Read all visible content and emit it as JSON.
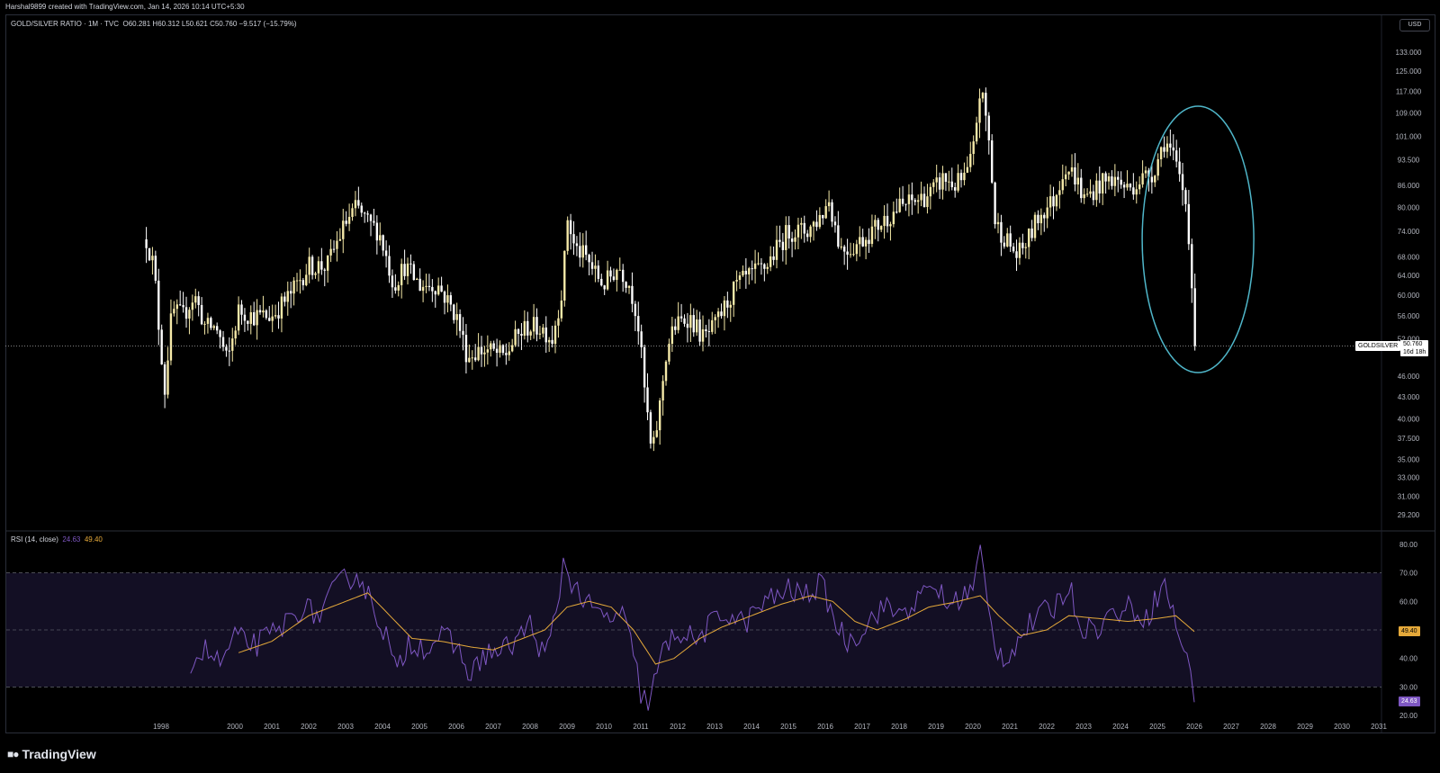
{
  "header": {
    "credit": "Harshal9899 created with TradingView.com, Jan 14, 2026 10:14 UTC+5:30"
  },
  "legend": {
    "symbol": "GOLD/SILVER RATIO · 1M · TVC",
    "o_label": "O",
    "o_value": "60.281",
    "h_label": "H",
    "h_value": "60.312",
    "l_label": "L",
    "l_value": "50.621",
    "c_label": "C",
    "c_value": "50.760",
    "change": "−9.517 (−15.79%)"
  },
  "currency": "USD",
  "price_tag": {
    "symbol": "GOLDSILVER",
    "value": "50.760",
    "countdown": "16d 18h"
  },
  "rsi_legend": {
    "label": "RSI (14, close)",
    "rsi_value": "24.63",
    "ma_value": "49.40"
  },
  "rsi_tags": {
    "ma": "49.40",
    "rsi": "24.63"
  },
  "brand": "TradingView",
  "colors": {
    "up_candle": "#f5e9a8",
    "down_candle": "#ffffff",
    "rsi_line": "#7e57c2",
    "rsi_ma": "#e5a93a",
    "rsi_band": "#130f24",
    "annotation": "#4fb6c9",
    "background": "#000000"
  },
  "chart_data": [
    {
      "type": "candlestick",
      "title": "GOLD/SILVER RATIO · 1M · TVC",
      "scale": "log",
      "y_ticks": [
        "133.000",
        "125.000",
        "117.000",
        "109.000",
        "101.000",
        "93.500",
        "86.000",
        "80.000",
        "74.000",
        "68.000",
        "64.000",
        "60.000",
        "56.000",
        "52.000",
        "46.000",
        "43.000",
        "40.000",
        "37.500",
        "35.000",
        "33.000",
        "31.000",
        "29.200"
      ],
      "x_ticks": [
        "1998",
        "2000",
        "2001",
        "2002",
        "2003",
        "2004",
        "2005",
        "2006",
        "2007",
        "2008",
        "2009",
        "2010",
        "2011",
        "2012",
        "2013",
        "2014",
        "2015",
        "2016",
        "2017",
        "2018",
        "2019",
        "2020",
        "2021",
        "2022",
        "2023",
        "2024",
        "2025",
        "2026",
        "2027",
        "2028",
        "2029",
        "2030",
        "2031"
      ],
      "last_close": 50.76,
      "approx_close_path": [
        [
          1997.6,
          72
        ],
        [
          1997.8,
          66
        ],
        [
          1997.95,
          53
        ],
        [
          1998.1,
          44
        ],
        [
          1998.3,
          57
        ],
        [
          1998.6,
          56
        ],
        [
          1998.9,
          60
        ],
        [
          1999.2,
          54
        ],
        [
          1999.5,
          54
        ],
        [
          1999.8,
          48
        ],
        [
          2000.1,
          57
        ],
        [
          2000.5,
          56
        ],
        [
          2001.0,
          56
        ],
        [
          2001.5,
          60
        ],
        [
          2002.0,
          66
        ],
        [
          2002.5,
          66
        ],
        [
          2003.0,
          76
        ],
        [
          2003.3,
          80
        ],
        [
          2003.6,
          76
        ],
        [
          2003.9,
          74
        ],
        [
          2004.1,
          68
        ],
        [
          2004.3,
          62
        ],
        [
          2004.6,
          66
        ],
        [
          2005.0,
          62
        ],
        [
          2005.5,
          62
        ],
        [
          2006.0,
          56
        ],
        [
          2006.3,
          49
        ],
        [
          2006.6,
          50
        ],
        [
          2006.9,
          50
        ],
        [
          2007.3,
          49
        ],
        [
          2007.6,
          52
        ],
        [
          2007.9,
          54
        ],
        [
          2008.3,
          54
        ],
        [
          2008.6,
          52
        ],
        [
          2008.9,
          62
        ],
        [
          2009.0,
          78
        ],
        [
          2009.2,
          70
        ],
        [
          2009.5,
          68
        ],
        [
          2009.8,
          64
        ],
        [
          2010.0,
          62
        ],
        [
          2010.4,
          66
        ],
        [
          2010.7,
          62
        ],
        [
          2010.9,
          56
        ],
        [
          2011.1,
          44
        ],
        [
          2011.3,
          35
        ],
        [
          2011.5,
          41
        ],
        [
          2011.7,
          50
        ],
        [
          2011.9,
          54
        ],
        [
          2012.3,
          56
        ],
        [
          2012.7,
          52
        ],
        [
          2013.0,
          54
        ],
        [
          2013.3,
          58
        ],
        [
          2013.6,
          62
        ],
        [
          2014.0,
          64
        ],
        [
          2014.4,
          66
        ],
        [
          2014.7,
          70
        ],
        [
          2015.0,
          74
        ],
        [
          2015.5,
          74
        ],
        [
          2015.9,
          78
        ],
        [
          2016.1,
          82
        ],
        [
          2016.4,
          70
        ],
        [
          2016.7,
          70
        ],
        [
          2017.0,
          72
        ],
        [
          2017.5,
          76
        ],
        [
          2018.0,
          80
        ],
        [
          2018.5,
          82
        ],
        [
          2018.9,
          84
        ],
        [
          2019.2,
          88
        ],
        [
          2019.5,
          86
        ],
        [
          2019.8,
          88
        ],
        [
          2020.0,
          95
        ],
        [
          2020.2,
          118
        ],
        [
          2020.4,
          104
        ],
        [
          2020.6,
          76
        ],
        [
          2020.9,
          72
        ],
        [
          2021.2,
          68
        ],
        [
          2021.5,
          72
        ],
        [
          2021.8,
          78
        ],
        [
          2022.2,
          82
        ],
        [
          2022.5,
          92
        ],
        [
          2022.8,
          88
        ],
        [
          2023.0,
          82
        ],
        [
          2023.4,
          86
        ],
        [
          2023.8,
          88
        ],
        [
          2024.2,
          85
        ],
        [
          2024.6,
          88
        ],
        [
          2024.9,
          90
        ],
        [
          2025.2,
          100
        ],
        [
          2025.4,
          95
        ],
        [
          2025.6,
          88
        ],
        [
          2025.8,
          80
        ],
        [
          2025.95,
          60
        ],
        [
          2026.05,
          50.76
        ]
      ]
    },
    {
      "type": "line",
      "title": "RSI (14, close)",
      "y_ticks": [
        "80.00",
        "70.00",
        "60.00",
        "50.00",
        "40.00",
        "30.00",
        "20.00"
      ],
      "bands": [
        30,
        70
      ],
      "midline": 50,
      "series": [
        {
          "name": "RSI",
          "last": 24.63,
          "points": [
            [
              1998.8,
              39
            ],
            [
              1999.2,
              43
            ],
            [
              1999.6,
              38
            ],
            [
              2000.0,
              47
            ],
            [
              2000.6,
              45
            ],
            [
              2001.2,
              50
            ],
            [
              2001.8,
              58
            ],
            [
              2002.3,
              55
            ],
            [
              2002.8,
              66
            ],
            [
              2003.3,
              70
            ],
            [
              2003.7,
              60
            ],
            [
              2004.1,
              48
            ],
            [
              2004.4,
              34
            ],
            [
              2004.7,
              46
            ],
            [
              2005.2,
              44
            ],
            [
              2005.6,
              48
            ],
            [
              2006.0,
              44
            ],
            [
              2006.4,
              34
            ],
            [
              2006.8,
              42
            ],
            [
              2007.2,
              42
            ],
            [
              2007.6,
              46
            ],
            [
              2008.0,
              52
            ],
            [
              2008.4,
              40
            ],
            [
              2008.7,
              55
            ],
            [
              2008.9,
              74
            ],
            [
              2009.2,
              65
            ],
            [
              2009.6,
              58
            ],
            [
              2010.0,
              54
            ],
            [
              2010.5,
              55
            ],
            [
              2010.8,
              42
            ],
            [
              2011.0,
              28
            ],
            [
              2011.2,
              24
            ],
            [
              2011.6,
              42
            ],
            [
              2012.0,
              50
            ],
            [
              2012.5,
              46
            ],
            [
              2012.9,
              52
            ],
            [
              2013.4,
              56
            ],
            [
              2013.8,
              52
            ],
            [
              2014.2,
              58
            ],
            [
              2014.7,
              62
            ],
            [
              2015.0,
              64
            ],
            [
              2015.4,
              62
            ],
            [
              2015.9,
              66
            ],
            [
              2016.3,
              52
            ],
            [
              2016.6,
              46
            ],
            [
              2017.0,
              50
            ],
            [
              2017.5,
              58
            ],
            [
              2018.0,
              56
            ],
            [
              2018.5,
              60
            ],
            [
              2019.0,
              66
            ],
            [
              2019.3,
              58
            ],
            [
              2019.7,
              62
            ],
            [
              2020.0,
              64
            ],
            [
              2020.2,
              78
            ],
            [
              2020.4,
              58
            ],
            [
              2020.6,
              44
            ],
            [
              2020.9,
              40
            ],
            [
              2021.3,
              48
            ],
            [
              2021.7,
              54
            ],
            [
              2022.2,
              58
            ],
            [
              2022.6,
              66
            ],
            [
              2022.9,
              52
            ],
            [
              2023.3,
              50
            ],
            [
              2023.8,
              56
            ],
            [
              2024.3,
              58
            ],
            [
              2024.7,
              54
            ],
            [
              2025.0,
              62
            ],
            [
              2025.2,
              66
            ],
            [
              2025.5,
              52
            ],
            [
              2025.8,
              40
            ],
            [
              2026.0,
              24.63
            ]
          ]
        },
        {
          "name": "RSI-based MA",
          "last": 49.4,
          "points": [
            [
              2000.1,
              42
            ],
            [
              2001.0,
              46
            ],
            [
              2002.0,
              55
            ],
            [
              2003.0,
              60
            ],
            [
              2003.6,
              63
            ],
            [
              2004.2,
              55
            ],
            [
              2004.8,
              47
            ],
            [
              2005.6,
              46
            ],
            [
              2006.4,
              44
            ],
            [
              2007.0,
              43
            ],
            [
              2007.8,
              47
            ],
            [
              2008.4,
              50
            ],
            [
              2009.0,
              58
            ],
            [
              2009.6,
              60
            ],
            [
              2010.2,
              58
            ],
            [
              2010.8,
              50
            ],
            [
              2011.4,
              38
            ],
            [
              2011.9,
              40
            ],
            [
              2012.6,
              47
            ],
            [
              2013.2,
              51
            ],
            [
              2014.0,
              55
            ],
            [
              2014.8,
              59
            ],
            [
              2015.6,
              62
            ],
            [
              2016.2,
              60
            ],
            [
              2016.8,
              53
            ],
            [
              2017.4,
              50
            ],
            [
              2018.2,
              54
            ],
            [
              2018.8,
              58
            ],
            [
              2019.6,
              60
            ],
            [
              2020.2,
              62
            ],
            [
              2020.7,
              55
            ],
            [
              2021.3,
              48
            ],
            [
              2022.0,
              50
            ],
            [
              2022.6,
              55
            ],
            [
              2023.4,
              54
            ],
            [
              2024.2,
              53
            ],
            [
              2025.0,
              54
            ],
            [
              2025.5,
              55
            ],
            [
              2026.0,
              49.4
            ]
          ]
        }
      ]
    }
  ]
}
